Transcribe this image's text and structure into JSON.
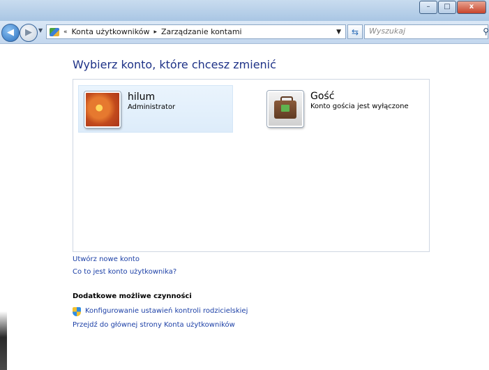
{
  "window": {
    "minimize_label": "–",
    "maximize_label": "□",
    "close_label": "x"
  },
  "address": {
    "overflow": "«",
    "crumb1": "Konta użytkowników",
    "crumb_sep": "▸",
    "crumb2": "Zarządzanie kontami"
  },
  "search": {
    "placeholder": "Wyszukaj"
  },
  "main": {
    "title": "Wybierz konto, które chcesz zmienić",
    "accounts": [
      {
        "name": "hilum",
        "role": "Administrator",
        "icon": "flower-avatar"
      },
      {
        "name": "Gość",
        "role": "Konto gościa jest wyłączone",
        "icon": "briefcase-avatar"
      }
    ],
    "links": {
      "create_account": "Utwórz nowe konto",
      "what_is_account": "Co to jest konto użytkownika?"
    },
    "additional": {
      "heading": "Dodatkowe możliwe czynności",
      "parental_controls": "Konfigurowanie ustawień kontroli rodzicielskiej",
      "main_page": "Przejdź do głównej strony Konta użytkowników"
    }
  },
  "colors": {
    "link": "#1b3fa6",
    "title": "#1e3287",
    "selection": "#ddecfa"
  }
}
